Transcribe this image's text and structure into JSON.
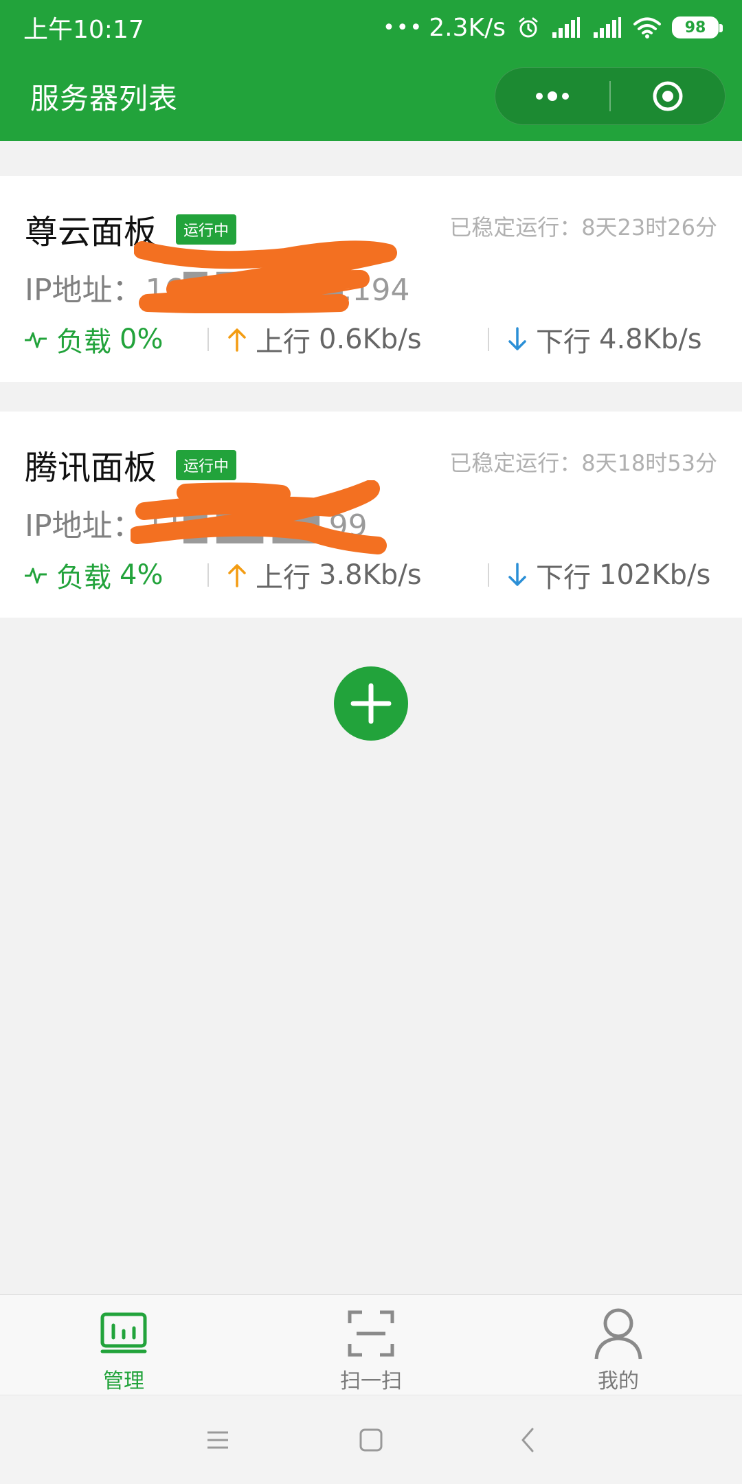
{
  "status_bar": {
    "time": "上午10:17",
    "network_speed": "2.3K/s",
    "battery": "98"
  },
  "nav": {
    "title": "服务器列表",
    "more_icon": "more-dots-icon",
    "close_icon": "target-circle-icon"
  },
  "servers": [
    {
      "name": "尊云面板",
      "status": "运行中",
      "uptime": "已稳定运行：8天23时26分",
      "ip_label": "IP地址：",
      "ip_value": "16█.██.███.194",
      "load_label": "负载",
      "load_value": "0%",
      "up_label": "上行",
      "up_value": "0.6Kb/s",
      "down_label": "下行",
      "down_value": "4.8Kb/s"
    },
    {
      "name": "腾讯面板",
      "status": "运行中",
      "uptime": "已稳定运行：8天18时53分",
      "ip_label": "IP地址：",
      "ip_value": "11█.██.██.99",
      "load_label": "负载",
      "load_value": "4%",
      "up_label": "上行",
      "up_value": "3.8Kb/s",
      "down_label": "下行",
      "down_value": "102Kb/s"
    }
  ],
  "add_button_icon": "plus-icon",
  "tabs": [
    {
      "label": "管理",
      "icon": "dashboard-icon",
      "active": true
    },
    {
      "label": "扫一扫",
      "icon": "scan-icon",
      "active": false
    },
    {
      "label": "我的",
      "icon": "user-icon",
      "active": false
    }
  ],
  "colors": {
    "primary": "#22a33b",
    "up_arrow": "#f39c12",
    "down_arrow": "#2b8fd6",
    "redaction": "#f37021"
  }
}
